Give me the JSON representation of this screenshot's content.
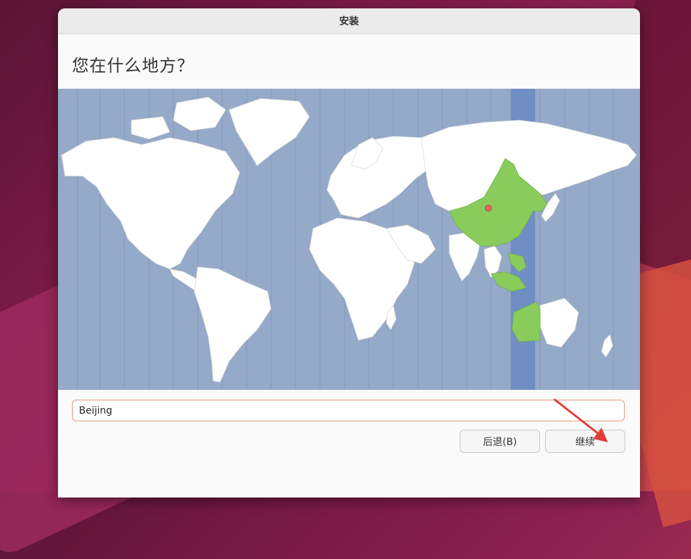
{
  "window": {
    "title": "安装"
  },
  "page": {
    "heading": "您在什么地方？"
  },
  "map": {
    "selected_city_marker": "pin-icon",
    "colors": {
      "ocean": "#95a9c8",
      "timezone_band_highlight": "#6f8fc4",
      "land": "#ffffff",
      "selected_zone": "#8acc5c",
      "marker": "#e46a64"
    }
  },
  "location_input": {
    "value": "Beijing"
  },
  "buttons": {
    "back_label": "后退(B)",
    "continue_label": "继续"
  },
  "annotation": {
    "arrow_color": "#e53b35"
  }
}
